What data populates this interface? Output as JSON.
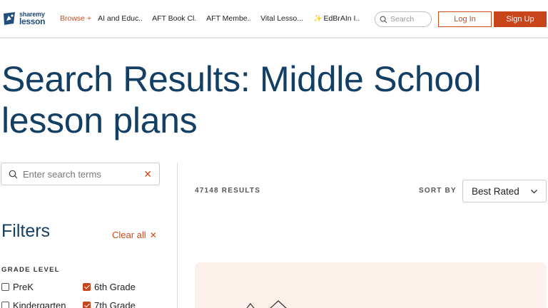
{
  "header": {
    "logo": {
      "line1": "sharemy",
      "line2": "lesson"
    },
    "nav": {
      "browse": "Browse +",
      "items": [
        "AI and Educ...",
        "AFT Book Cl...",
        "AFT Membe...",
        "Vital Lesso...",
        "EdBrAIn I..."
      ]
    },
    "search": {
      "placeholder": "Search"
    },
    "login_label": "Log In",
    "signup_label": "Sign Up",
    "colors": {
      "accent": "#d04a1c",
      "brand": "#143f64"
    }
  },
  "page": {
    "title": "Search Results: Middle School lesson plans"
  },
  "sidebar": {
    "search": {
      "placeholder": "Enter search terms",
      "value": ""
    },
    "filters_title": "Filters",
    "clear_all_label": "Clear all",
    "grade_level_label": "GRADE LEVEL",
    "grades": [
      {
        "label": "PreK",
        "checked": false
      },
      {
        "label": "6th Grade",
        "checked": true
      },
      {
        "label": "Kindergarten",
        "checked": false
      },
      {
        "label": "7th Grade",
        "checked": true
      }
    ]
  },
  "results": {
    "count_label": "47148 RESULTS",
    "sort_by_label": "SORT BY",
    "sort_selected": "Best Rated"
  }
}
